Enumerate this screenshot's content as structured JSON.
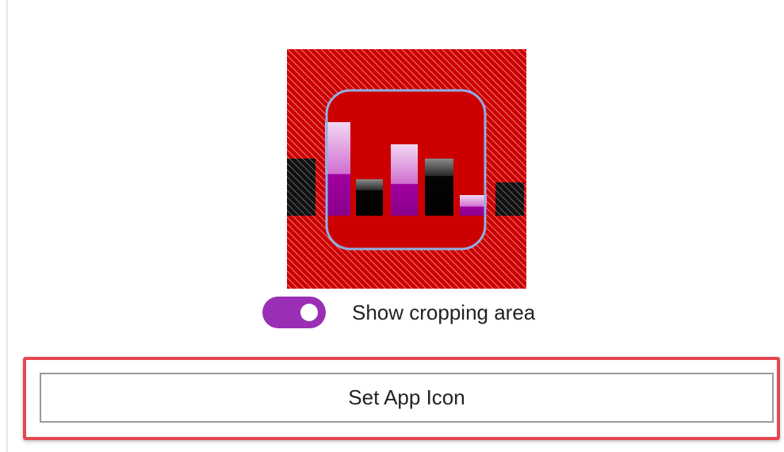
{
  "cropping": {
    "toggle_on": true,
    "label": "Show cropping area"
  },
  "actions": {
    "set_icon_label": "Set App Icon"
  },
  "colors": {
    "accent": "#9a2fb5",
    "icon_background": "#cc0000",
    "crop_outline": "#8fb0e6",
    "highlight": "#e5484f"
  },
  "icons": {
    "app_icon": "bar-chart-icon"
  }
}
